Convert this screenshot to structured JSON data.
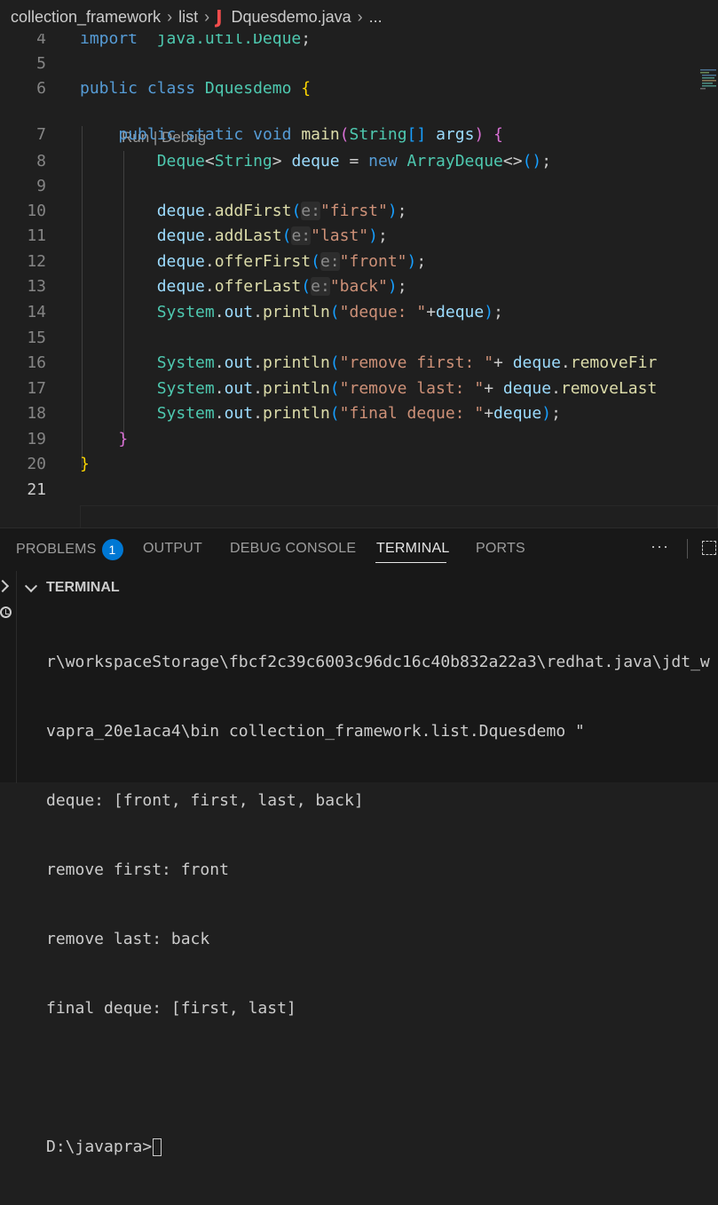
{
  "breadcrumb": {
    "items": [
      "collection_framework",
      "list"
    ],
    "file": "Dquesdemo.java",
    "ellipsis": "..."
  },
  "editor": {
    "codelens": "Run | Debug",
    "lines": [
      {
        "n": "4",
        "tokens": [
          [
            "kw",
            "import"
          ],
          [
            "",
            "  "
          ],
          [
            "ty",
            "java.util.Deque"
          ],
          [
            "",
            "; "
          ]
        ]
      },
      {
        "n": "5",
        "tokens": []
      },
      {
        "n": "6",
        "tokens": [
          [
            "kw",
            "public"
          ],
          [
            "",
            " "
          ],
          [
            "kw",
            "class"
          ],
          [
            "",
            " "
          ],
          [
            "ty",
            "Dquesdemo"
          ],
          [
            "",
            " "
          ],
          [
            "br1",
            "{"
          ]
        ]
      },
      {
        "n": "7",
        "tokens": [
          [
            "",
            "    "
          ],
          [
            "kw",
            "public"
          ],
          [
            "",
            " "
          ],
          [
            "kw",
            "static"
          ],
          [
            "",
            " "
          ],
          [
            "kw",
            "void"
          ],
          [
            "",
            " "
          ],
          [
            "fn",
            "main"
          ],
          [
            "br2",
            "("
          ],
          [
            "ty",
            "String"
          ],
          [
            "br3",
            "[]"
          ],
          [
            "",
            " "
          ],
          [
            "va",
            "args"
          ],
          [
            "br2",
            ")"
          ],
          [
            "",
            " "
          ],
          [
            "br2",
            "{"
          ]
        ]
      },
      {
        "n": "8",
        "tokens": [
          [
            "",
            "        "
          ],
          [
            "ty",
            "Deque"
          ],
          [
            "",
            "<"
          ],
          [
            "ty",
            "String"
          ],
          [
            "",
            "> "
          ],
          [
            "va",
            "deque"
          ],
          [
            "",
            " = "
          ],
          [
            "kw",
            "new"
          ],
          [
            "",
            " "
          ],
          [
            "ty",
            "ArrayDeque"
          ],
          [
            "",
            "<>"
          ],
          [
            "br3",
            "()"
          ],
          [
            "",
            ";"
          ]
        ]
      },
      {
        "n": "9",
        "tokens": []
      },
      {
        "n": "10",
        "tokens": [
          [
            "",
            "        "
          ],
          [
            "va",
            "deque"
          ],
          [
            "",
            "."
          ],
          [
            "fn",
            "addFirst"
          ],
          [
            "br3",
            "("
          ],
          [
            "hint",
            "e:"
          ],
          [
            "st",
            "\"first\""
          ],
          [
            "br3",
            ")"
          ],
          [
            "",
            ";"
          ]
        ]
      },
      {
        "n": "11",
        "tokens": [
          [
            "",
            "        "
          ],
          [
            "va",
            "deque"
          ],
          [
            "",
            "."
          ],
          [
            "fn",
            "addLast"
          ],
          [
            "br3",
            "("
          ],
          [
            "hint",
            "e:"
          ],
          [
            "st",
            "\"last\""
          ],
          [
            "br3",
            ")"
          ],
          [
            "",
            ";"
          ]
        ]
      },
      {
        "n": "12",
        "tokens": [
          [
            "",
            "        "
          ],
          [
            "va",
            "deque"
          ],
          [
            "",
            "."
          ],
          [
            "fn",
            "offerFirst"
          ],
          [
            "br3",
            "("
          ],
          [
            "hint",
            "e:"
          ],
          [
            "st",
            "\"front\""
          ],
          [
            "br3",
            ")"
          ],
          [
            "",
            ";"
          ]
        ]
      },
      {
        "n": "13",
        "tokens": [
          [
            "",
            "        "
          ],
          [
            "va",
            "deque"
          ],
          [
            "",
            "."
          ],
          [
            "fn",
            "offerLast"
          ],
          [
            "br3",
            "("
          ],
          [
            "hint",
            "e:"
          ],
          [
            "st",
            "\"back\""
          ],
          [
            "br3",
            ")"
          ],
          [
            "",
            ";"
          ]
        ]
      },
      {
        "n": "14",
        "tokens": [
          [
            "",
            "        "
          ],
          [
            "ty",
            "System"
          ],
          [
            "",
            "."
          ],
          [
            "va",
            "out"
          ],
          [
            "",
            "."
          ],
          [
            "fn",
            "println"
          ],
          [
            "br3",
            "("
          ],
          [
            "st",
            "\"deque: \""
          ],
          [
            "",
            "+"
          ],
          [
            "va",
            "deque"
          ],
          [
            "br3",
            ")"
          ],
          [
            "",
            ";"
          ]
        ]
      },
      {
        "n": "15",
        "tokens": []
      },
      {
        "n": "16",
        "tokens": [
          [
            "",
            "        "
          ],
          [
            "ty",
            "System"
          ],
          [
            "",
            "."
          ],
          [
            "va",
            "out"
          ],
          [
            "",
            "."
          ],
          [
            "fn",
            "println"
          ],
          [
            "br3",
            "("
          ],
          [
            "st",
            "\"remove first: \""
          ],
          [
            "",
            "+ "
          ],
          [
            "va",
            "deque"
          ],
          [
            "",
            "."
          ],
          [
            "fn",
            "removeFir"
          ]
        ]
      },
      {
        "n": "17",
        "tokens": [
          [
            "",
            "        "
          ],
          [
            "ty",
            "System"
          ],
          [
            "",
            "."
          ],
          [
            "va",
            "out"
          ],
          [
            "",
            "."
          ],
          [
            "fn",
            "println"
          ],
          [
            "br3",
            "("
          ],
          [
            "st",
            "\"remove last: \""
          ],
          [
            "",
            "+ "
          ],
          [
            "va",
            "deque"
          ],
          [
            "",
            "."
          ],
          [
            "fn",
            "removeLast"
          ]
        ]
      },
      {
        "n": "18",
        "tokens": [
          [
            "",
            "        "
          ],
          [
            "ty",
            "System"
          ],
          [
            "",
            "."
          ],
          [
            "va",
            "out"
          ],
          [
            "",
            "."
          ],
          [
            "fn",
            "println"
          ],
          [
            "br3",
            "("
          ],
          [
            "st",
            "\"final deque: \""
          ],
          [
            "",
            "+"
          ],
          [
            "va",
            "deque"
          ],
          [
            "br3",
            ")"
          ],
          [
            "",
            ";"
          ]
        ]
      },
      {
        "n": "19",
        "tokens": [
          [
            "",
            "    "
          ],
          [
            "br2",
            "}"
          ]
        ]
      },
      {
        "n": "20",
        "tokens": [
          [
            "br1",
            "}"
          ]
        ]
      },
      {
        "n": "21",
        "tokens": []
      }
    ],
    "active_line": "21"
  },
  "panel": {
    "tabs": [
      {
        "label": "PROBLEMS",
        "badge": "1"
      },
      {
        "label": "OUTPUT"
      },
      {
        "label": "DEBUG CONSOLE"
      },
      {
        "label": "TERMINAL",
        "active": true
      },
      {
        "label": "PORTS"
      }
    ],
    "more": "···",
    "terminal_title": "TERMINAL",
    "terminal_lines": [
      "r\\workspaceStorage\\fbcf2c39c6003c96dc16c40b832a22a3\\redhat.java\\jdt_w",
      "vapra_20e1aca4\\bin collection_framework.list.Dquesdemo \"",
      "deque: [front, first, last, back]",
      "remove first: front",
      "remove last: back",
      "final deque: [first, last]",
      "",
      "D:\\javapra>"
    ]
  },
  "colors": {
    "editor_bg": "#1f1f1f",
    "panel_bg": "#181818",
    "accent": "#0078d4",
    "keyword": "#569cd6",
    "type": "#4ec9b0",
    "function": "#dcdcaa",
    "string": "#ce9178",
    "variable": "#9cdcfe"
  }
}
